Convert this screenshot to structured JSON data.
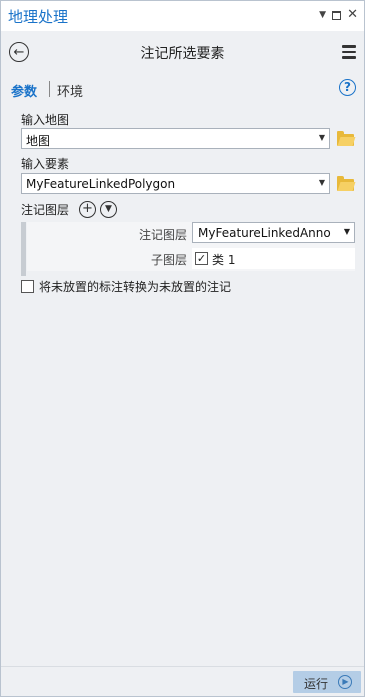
{
  "pane": {
    "title": "地理处理"
  },
  "tool": {
    "title": "注记所选要素"
  },
  "tabs": {
    "parameters": "参数",
    "environments": "环境"
  },
  "help": {
    "icon": "?"
  },
  "params": {
    "input_map": {
      "label": "输入地图",
      "value": "地图"
    },
    "input_features": {
      "label": "输入要素",
      "value": "MyFeatureLinkedPolygon"
    },
    "annotation_layers": {
      "label": "注记图层",
      "annotation_layer_label": "注记图层",
      "annotation_layer_value": "MyFeatureLinkedAnno",
      "sublayer_label": "子图层",
      "sublayer_item": "类 1",
      "sublayer_checked": true
    },
    "convert_unplaced": {
      "label": "将未放置的标注转换为未放置的注记",
      "checked": false
    }
  },
  "footer": {
    "run_label": "运行"
  },
  "icons": {
    "back": "back-arrow-icon",
    "menu": "hamburger-menu-icon",
    "folder": "folder-icon",
    "add": "plus-circle-icon",
    "expand": "chevron-down-circle-icon"
  },
  "colors": {
    "accent": "#1a73c9",
    "run_button": "#b4cde6",
    "folder": "#e8b93a"
  }
}
